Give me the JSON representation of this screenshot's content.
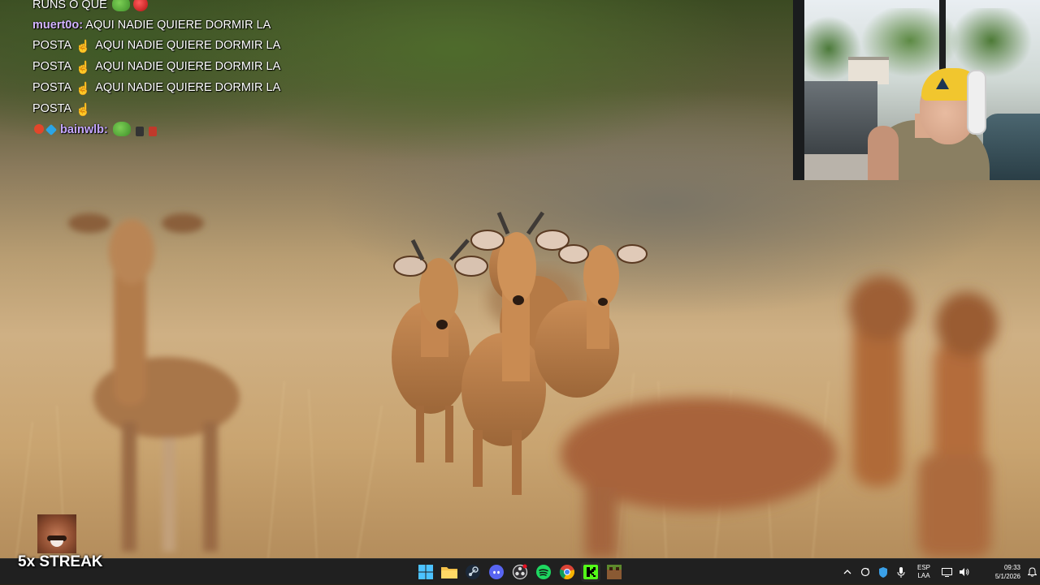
{
  "chat": {
    "lines": [
      {
        "text": "RUNS O QUE"
      },
      {
        "user": "muert0o",
        "text": "AQUI NADIE QUIERE DORMIR LA"
      },
      {
        "text": "POSTA",
        "tail": "AQUI NADIE QUIERE DORMIR LA"
      },
      {
        "text": "POSTA",
        "tail": "AQUI NADIE QUIERE DORMIR LA"
      },
      {
        "text": "POSTA",
        "tail": "AQUI NADIE QUIERE DORMIR LA"
      },
      {
        "text": "POSTA"
      },
      {
        "user": "bainwlb",
        "text": ""
      }
    ],
    "colors": {
      "muert0o": "#d3b4ff",
      "bainwlb": "#c4a6ff"
    }
  },
  "streak": {
    "label": "5x STREAK"
  },
  "taskbar": {
    "apps": [
      {
        "name": "windows-start",
        "icon": "windows-logo-icon"
      },
      {
        "name": "file-explorer",
        "icon": "folder-icon"
      },
      {
        "name": "steam",
        "icon": "steam-icon"
      },
      {
        "name": "discord",
        "icon": "discord-icon"
      },
      {
        "name": "obs",
        "icon": "obs-icon"
      },
      {
        "name": "spotify",
        "icon": "spotify-icon"
      },
      {
        "name": "chrome",
        "icon": "chrome-icon"
      },
      {
        "name": "kick",
        "icon": "kick-icon"
      },
      {
        "name": "minecraft",
        "icon": "minecraft-icon"
      }
    ],
    "tray": {
      "lang_top": "ESP",
      "lang_bottom": "LAA",
      "time": "09:33",
      "date": "5/1/2026"
    }
  },
  "colors": {
    "taskbar_bg": "#202020",
    "accent_green": "#53fc18",
    "spotify_green": "#1ed760"
  }
}
